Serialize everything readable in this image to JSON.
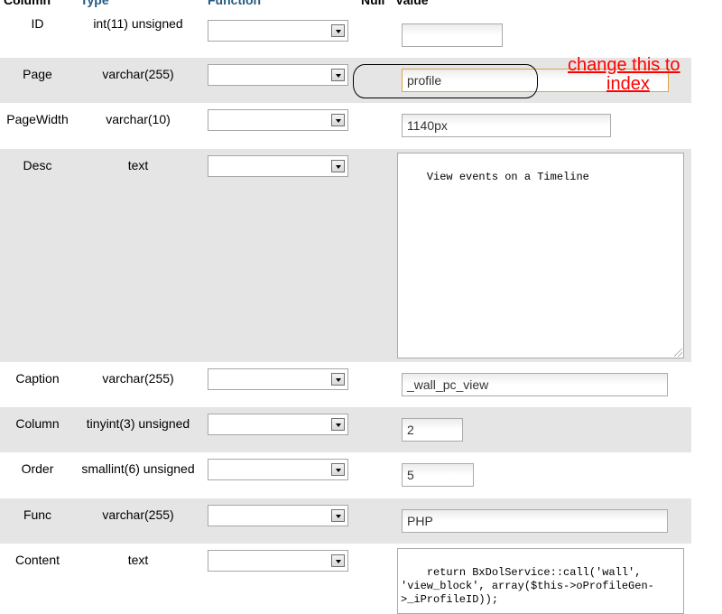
{
  "header": {
    "col_column": "Column",
    "col_type": "Type",
    "col_function": "Function",
    "col_null": "Null",
    "col_value": "Value"
  },
  "rows": [
    {
      "column": "ID",
      "type": "int(11) unsigned",
      "value": ""
    },
    {
      "column": "Page",
      "type": "varchar(255)",
      "value": "profile"
    },
    {
      "column": "PageWidth",
      "type": "varchar(10)",
      "value": "1140px"
    },
    {
      "column": "Desc",
      "type": "text",
      "value": "View events on a Timeline"
    },
    {
      "column": "Caption",
      "type": "varchar(255)",
      "value": "_wall_pc_view"
    },
    {
      "column": "Column",
      "type": "tinyint(3) unsigned",
      "value": "2"
    },
    {
      "column": "Order",
      "type": "smallint(6) unsigned",
      "value": "5"
    },
    {
      "column": "Func",
      "type": "varchar(255)",
      "value": "PHP"
    },
    {
      "column": "Content",
      "type": "text",
      "value": "return BxDolService::call('wall', 'view_block', array($this->oProfileGen->_iProfileID));"
    }
  ],
  "annotation": {
    "line1": "change this to",
    "line2": "index",
    "color": "#ff0000"
  },
  "colors": {
    "row_alt": "#e5e5e5",
    "header_blue": "#235a81",
    "highlight_border": "#e0a23c"
  }
}
